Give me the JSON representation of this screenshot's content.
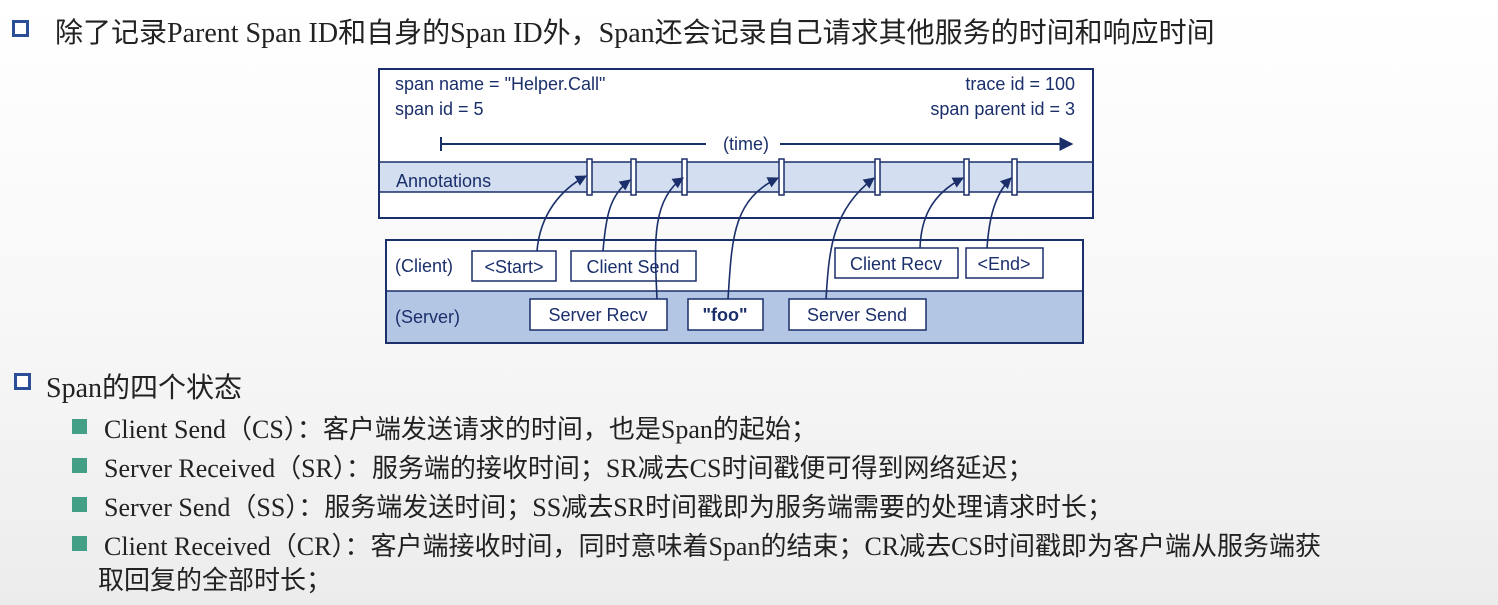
{
  "heading": "除了记录Parent Span ID和自身的Span ID外，Span还会记录自己请求其他服务的时间和响应时间",
  "diagram": {
    "span_name": "span name = \"Helper.Call\"",
    "span_id": "span id = 5",
    "trace_id": "trace id = 100",
    "span_parent_id": "span parent id = 3",
    "time_label": "(time)",
    "annotations_label": "Annotations",
    "client_label": "(Client)",
    "server_label": "(Server)",
    "start": "<Start>",
    "client_send": "Client Send",
    "client_recv": "Client Recv",
    "end": "<End>",
    "server_recv": "Server Recv",
    "foo": "\"foo\"",
    "server_send": "Server Send",
    "colors": {
      "line": "#1b2f6b",
      "band": "#d3def0",
      "serverband": "#b3c6e4"
    }
  },
  "section2_title": "Span的四个状态",
  "bullets": [
    "Client Send（CS）：客户端发送请求的时间，也是Span的起始；",
    "Server Received（SR）：服务端的接收时间；SR减去CS时间戳便可得到网络延迟；",
    "Server Send（SS）：服务端发送时间；SS减去SR时间戳即为服务端需要的处理请求时长；",
    "Client Received（CR）：客户端接收时间，同时意味着Span的结束；CR减去CS时间戳即为客户端从服务端获"
  ],
  "bullet4_cont": "取回复的全部时长；"
}
